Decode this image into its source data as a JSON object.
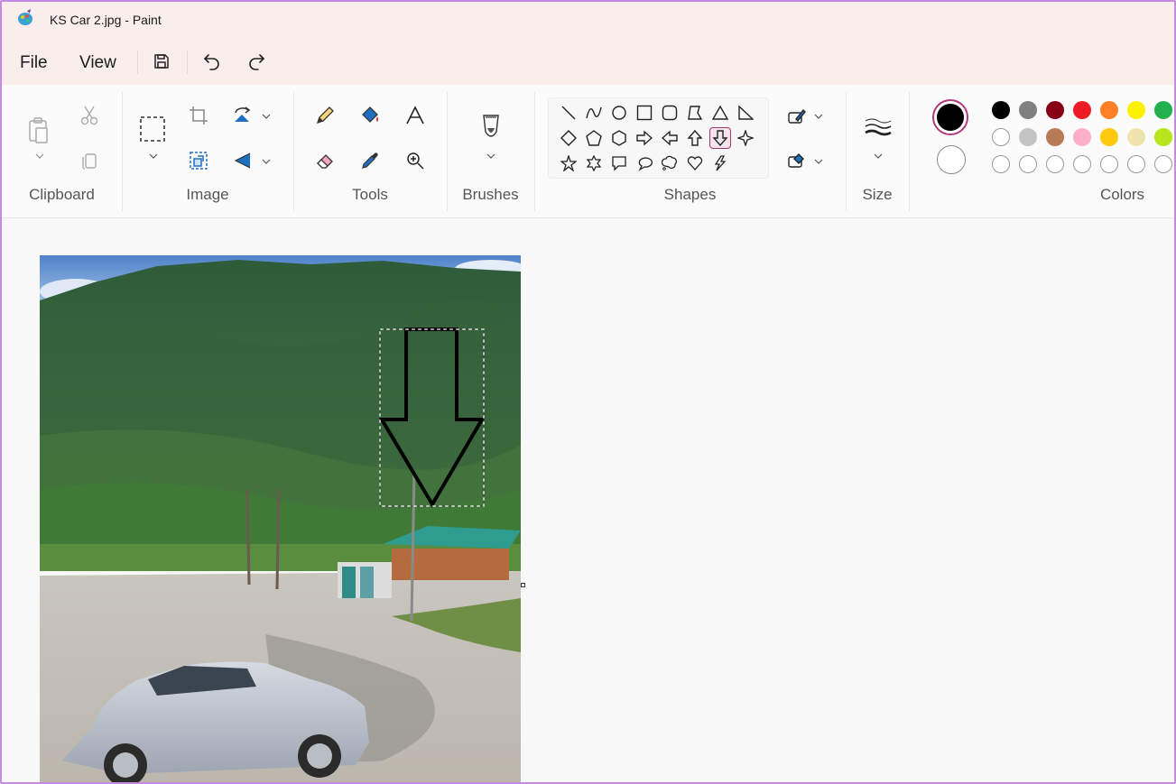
{
  "window": {
    "title": "KS Car 2.jpg - Paint",
    "app_icon": "paint-icon"
  },
  "menu": {
    "file": "File",
    "view": "View",
    "save_icon": "save-icon",
    "undo_icon": "undo-icon",
    "redo_icon": "redo-icon"
  },
  "ribbon": {
    "groups": {
      "clipboard": "Clipboard",
      "image": "Image",
      "tools": "Tools",
      "brushes": "Brushes",
      "shapes": "Shapes",
      "size": "Size",
      "colors": "Colors"
    },
    "selected_shape": "down-arrow",
    "colors": {
      "primary": "#000000",
      "secondary": "#ffffff",
      "palette_row1": [
        "#000000",
        "#7f7f7f",
        "#880015",
        "#ed1c24",
        "#ff7f27",
        "#fff200",
        "#22b14c"
      ],
      "palette_row2": [
        "#ffffff",
        "#c3c3c3",
        "#b97a57",
        "#ffaec9",
        "#ffc90e",
        "#efe4b0",
        "#b5e61d"
      ],
      "palette_row3": [
        "",
        "",
        "",
        "",
        "",
        "",
        ""
      ],
      "accent": "#b23a7a"
    }
  },
  "canvas": {
    "image_name": "KS Car 2.jpg",
    "drawn_shape": "down-arrow"
  }
}
